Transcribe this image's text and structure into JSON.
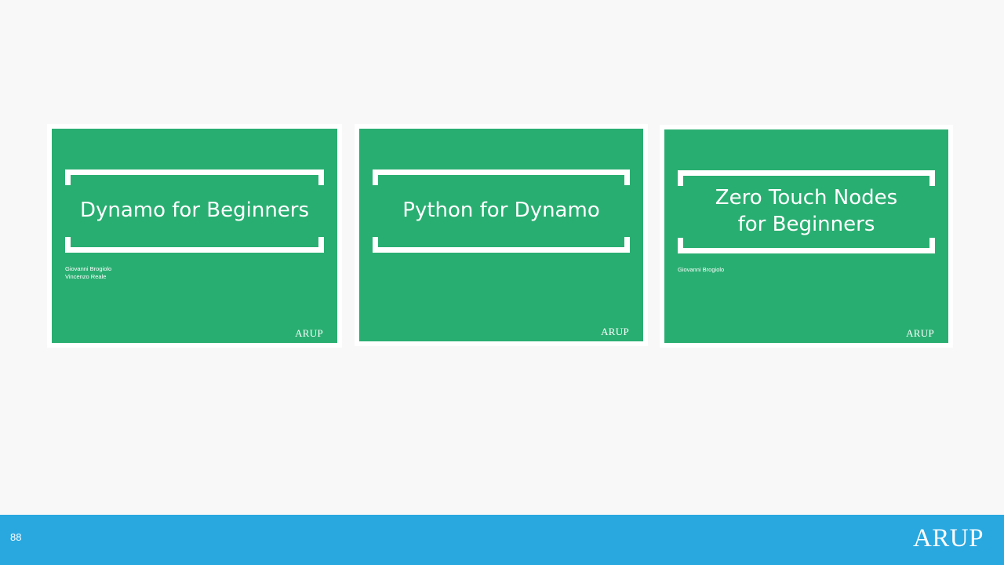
{
  "thumbnails": [
    {
      "title": "Dynamo for Beginners",
      "authors": [
        "Giovanni Brogiolo",
        "Vincenzo Reale"
      ],
      "brand": "ARUP"
    },
    {
      "title": "Python for Dynamo",
      "authors": [],
      "brand": "ARUP"
    },
    {
      "title": "Zero Touch Nodes\nfor Beginners",
      "authors": [
        "Giovanni Brogiolo"
      ],
      "brand": "ARUP"
    }
  ],
  "footer": {
    "page_number": "88",
    "brand": "ARUP"
  },
  "colors": {
    "thumbnail_green": "#29ae71",
    "footer_blue": "#29a8e0",
    "background": "#f8f8f8"
  }
}
